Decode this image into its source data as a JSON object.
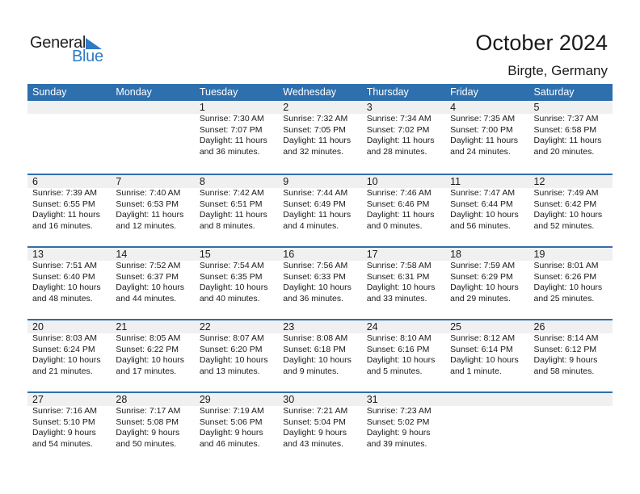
{
  "logo": {
    "general": "General",
    "blue": "Blue"
  },
  "header": {
    "title": "October 2024",
    "location": "Birgte, Germany"
  },
  "weekdays": [
    "Sunday",
    "Monday",
    "Tuesday",
    "Wednesday",
    "Thursday",
    "Friday",
    "Saturday"
  ],
  "colors": {
    "accent": "#2e6fad",
    "logo_blue": "#2e7bc4",
    "band": "#f0f0f0"
  },
  "weeks": [
    [
      null,
      null,
      {
        "day": "1",
        "sunrise": "Sunrise: 7:30 AM",
        "sunset": "Sunset: 7:07 PM",
        "daylight1": "Daylight: 11 hours",
        "daylight2": "and 36 minutes."
      },
      {
        "day": "2",
        "sunrise": "Sunrise: 7:32 AM",
        "sunset": "Sunset: 7:05 PM",
        "daylight1": "Daylight: 11 hours",
        "daylight2": "and 32 minutes."
      },
      {
        "day": "3",
        "sunrise": "Sunrise: 7:34 AM",
        "sunset": "Sunset: 7:02 PM",
        "daylight1": "Daylight: 11 hours",
        "daylight2": "and 28 minutes."
      },
      {
        "day": "4",
        "sunrise": "Sunrise: 7:35 AM",
        "sunset": "Sunset: 7:00 PM",
        "daylight1": "Daylight: 11 hours",
        "daylight2": "and 24 minutes."
      },
      {
        "day": "5",
        "sunrise": "Sunrise: 7:37 AM",
        "sunset": "Sunset: 6:58 PM",
        "daylight1": "Daylight: 11 hours",
        "daylight2": "and 20 minutes."
      }
    ],
    [
      {
        "day": "6",
        "sunrise": "Sunrise: 7:39 AM",
        "sunset": "Sunset: 6:55 PM",
        "daylight1": "Daylight: 11 hours",
        "daylight2": "and 16 minutes."
      },
      {
        "day": "7",
        "sunrise": "Sunrise: 7:40 AM",
        "sunset": "Sunset: 6:53 PM",
        "daylight1": "Daylight: 11 hours",
        "daylight2": "and 12 minutes."
      },
      {
        "day": "8",
        "sunrise": "Sunrise: 7:42 AM",
        "sunset": "Sunset: 6:51 PM",
        "daylight1": "Daylight: 11 hours",
        "daylight2": "and 8 minutes."
      },
      {
        "day": "9",
        "sunrise": "Sunrise: 7:44 AM",
        "sunset": "Sunset: 6:49 PM",
        "daylight1": "Daylight: 11 hours",
        "daylight2": "and 4 minutes."
      },
      {
        "day": "10",
        "sunrise": "Sunrise: 7:46 AM",
        "sunset": "Sunset: 6:46 PM",
        "daylight1": "Daylight: 11 hours",
        "daylight2": "and 0 minutes."
      },
      {
        "day": "11",
        "sunrise": "Sunrise: 7:47 AM",
        "sunset": "Sunset: 6:44 PM",
        "daylight1": "Daylight: 10 hours",
        "daylight2": "and 56 minutes."
      },
      {
        "day": "12",
        "sunrise": "Sunrise: 7:49 AM",
        "sunset": "Sunset: 6:42 PM",
        "daylight1": "Daylight: 10 hours",
        "daylight2": "and 52 minutes."
      }
    ],
    [
      {
        "day": "13",
        "sunrise": "Sunrise: 7:51 AM",
        "sunset": "Sunset: 6:40 PM",
        "daylight1": "Daylight: 10 hours",
        "daylight2": "and 48 minutes."
      },
      {
        "day": "14",
        "sunrise": "Sunrise: 7:52 AM",
        "sunset": "Sunset: 6:37 PM",
        "daylight1": "Daylight: 10 hours",
        "daylight2": "and 44 minutes."
      },
      {
        "day": "15",
        "sunrise": "Sunrise: 7:54 AM",
        "sunset": "Sunset: 6:35 PM",
        "daylight1": "Daylight: 10 hours",
        "daylight2": "and 40 minutes."
      },
      {
        "day": "16",
        "sunrise": "Sunrise: 7:56 AM",
        "sunset": "Sunset: 6:33 PM",
        "daylight1": "Daylight: 10 hours",
        "daylight2": "and 36 minutes."
      },
      {
        "day": "17",
        "sunrise": "Sunrise: 7:58 AM",
        "sunset": "Sunset: 6:31 PM",
        "daylight1": "Daylight: 10 hours",
        "daylight2": "and 33 minutes."
      },
      {
        "day": "18",
        "sunrise": "Sunrise: 7:59 AM",
        "sunset": "Sunset: 6:29 PM",
        "daylight1": "Daylight: 10 hours",
        "daylight2": "and 29 minutes."
      },
      {
        "day": "19",
        "sunrise": "Sunrise: 8:01 AM",
        "sunset": "Sunset: 6:26 PM",
        "daylight1": "Daylight: 10 hours",
        "daylight2": "and 25 minutes."
      }
    ],
    [
      {
        "day": "20",
        "sunrise": "Sunrise: 8:03 AM",
        "sunset": "Sunset: 6:24 PM",
        "daylight1": "Daylight: 10 hours",
        "daylight2": "and 21 minutes."
      },
      {
        "day": "21",
        "sunrise": "Sunrise: 8:05 AM",
        "sunset": "Sunset: 6:22 PM",
        "daylight1": "Daylight: 10 hours",
        "daylight2": "and 17 minutes."
      },
      {
        "day": "22",
        "sunrise": "Sunrise: 8:07 AM",
        "sunset": "Sunset: 6:20 PM",
        "daylight1": "Daylight: 10 hours",
        "daylight2": "and 13 minutes."
      },
      {
        "day": "23",
        "sunrise": "Sunrise: 8:08 AM",
        "sunset": "Sunset: 6:18 PM",
        "daylight1": "Daylight: 10 hours",
        "daylight2": "and 9 minutes."
      },
      {
        "day": "24",
        "sunrise": "Sunrise: 8:10 AM",
        "sunset": "Sunset: 6:16 PM",
        "daylight1": "Daylight: 10 hours",
        "daylight2": "and 5 minutes."
      },
      {
        "day": "25",
        "sunrise": "Sunrise: 8:12 AM",
        "sunset": "Sunset: 6:14 PM",
        "daylight1": "Daylight: 10 hours",
        "daylight2": "and 1 minute."
      },
      {
        "day": "26",
        "sunrise": "Sunrise: 8:14 AM",
        "sunset": "Sunset: 6:12 PM",
        "daylight1": "Daylight: 9 hours",
        "daylight2": "and 58 minutes."
      }
    ],
    [
      {
        "day": "27",
        "sunrise": "Sunrise: 7:16 AM",
        "sunset": "Sunset: 5:10 PM",
        "daylight1": "Daylight: 9 hours",
        "daylight2": "and 54 minutes."
      },
      {
        "day": "28",
        "sunrise": "Sunrise: 7:17 AM",
        "sunset": "Sunset: 5:08 PM",
        "daylight1": "Daylight: 9 hours",
        "daylight2": "and 50 minutes."
      },
      {
        "day": "29",
        "sunrise": "Sunrise: 7:19 AM",
        "sunset": "Sunset: 5:06 PM",
        "daylight1": "Daylight: 9 hours",
        "daylight2": "and 46 minutes."
      },
      {
        "day": "30",
        "sunrise": "Sunrise: 7:21 AM",
        "sunset": "Sunset: 5:04 PM",
        "daylight1": "Daylight: 9 hours",
        "daylight2": "and 43 minutes."
      },
      {
        "day": "31",
        "sunrise": "Sunrise: 7:23 AM",
        "sunset": "Sunset: 5:02 PM",
        "daylight1": "Daylight: 9 hours",
        "daylight2": "and 39 minutes."
      },
      null,
      null
    ]
  ]
}
